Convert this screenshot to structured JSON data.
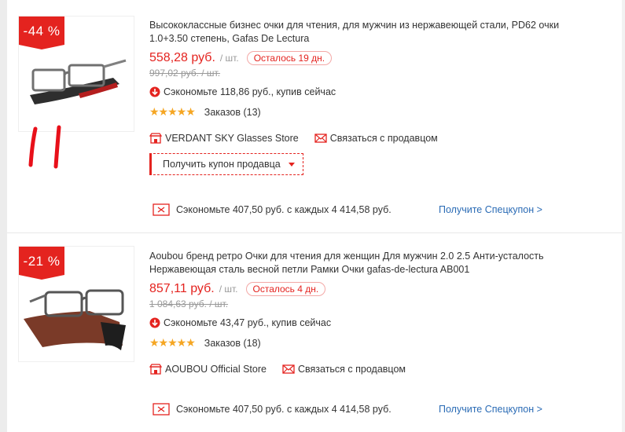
{
  "products": [
    {
      "discount": "-44 %",
      "title": "Высококлассные бизнес очки для чтения, для мужчин из нержавеющей стали, PD62 очки 1.0+3.50 степень, Gafas De Lectura",
      "price": "558,28 руб.",
      "unit": "/ шт.",
      "days_left": "Осталось 19 дн.",
      "old_price": "997,02 руб. / шт.",
      "save_now": "Сэкономьте 118,86 руб., купив сейчас",
      "rating_stars": 5,
      "orders": "Заказов (13)",
      "store": "VERDANT SKY Glasses Store",
      "contact": "Связаться с продавцом",
      "coupon_button": "Получить купон продавца",
      "special_text": "Сэкономьте 407,50 руб. с каждых 4 414,58 руб.",
      "special_link": "Получите Спецкупон >"
    },
    {
      "discount": "-21 %",
      "title": "Aoubou бренд ретро Очки для чтения для женщин Для мужчин 2.0 2.5 Анти-усталость Нержавеющая сталь весной петли Рамки Очки gafas-de-lectura AB001",
      "price": "857,11 руб.",
      "unit": "/ шт.",
      "days_left": "Осталось 4 дн.",
      "old_price": "1 084,63 руб. / шт.",
      "save_now": "Сэкономьте 43,47 руб., купив сейчас",
      "rating_stars": 5,
      "orders": "Заказов (18)",
      "store": "AOUBOU Official Store",
      "contact": "Связаться с продавцом",
      "special_text": "Сэкономьте 407,50 руб. с каждых 4 414,58 руб.",
      "special_link": "Получите Спецкупон >"
    }
  ],
  "stars_glyph": "★★★★★",
  "colors": {
    "accent": "#e4231f",
    "star": "#f5a623",
    "link": "#2a6bb5",
    "scribble": "#e8101a"
  },
  "icons": [
    "arrow-down-circle-icon",
    "store-icon",
    "mail-icon",
    "ticket-icon",
    "caret-down-icon"
  ]
}
